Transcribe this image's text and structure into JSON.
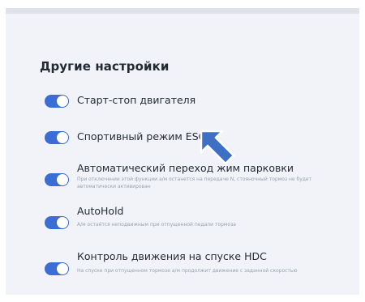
{
  "section": {
    "title": "Другие настройки"
  },
  "settings": [
    {
      "label": "Старт-стоп двигателя",
      "description": "",
      "enabled": true
    },
    {
      "label": "Спортивный режим ESC",
      "description": "",
      "enabled": true
    },
    {
      "label": "Автоматический переход жим парковки",
      "description": "При отключении этой функции а/м останется на передаче N, стояночный тормоз не будет автоматически активирован",
      "enabled": true
    },
    {
      "label": "AutoHold",
      "description": "А/м остаётся неподвижным при отпущенной педали тормоза",
      "enabled": true
    },
    {
      "label": "Контроль движения на спуске HDC",
      "description": "На спуске при отпущенном тормозе а/м продолжит движение с заданной скоростью",
      "enabled": true
    }
  ],
  "colors": {
    "toggle_on": "#3a6ed6",
    "cursor": "#3d6fc4",
    "panel_bg": "#f1f3f8"
  },
  "icons": {
    "pointer": "arrow-cursor-icon"
  }
}
